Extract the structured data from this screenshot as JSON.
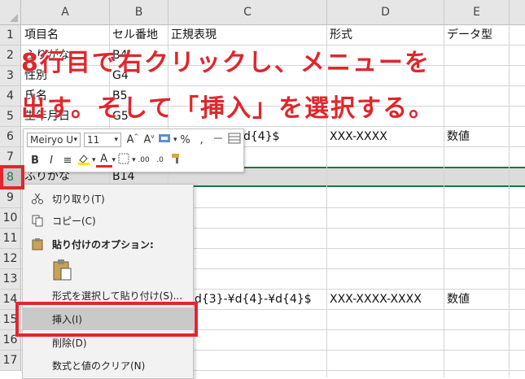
{
  "columns": [
    "A",
    "B",
    "C",
    "D",
    "E"
  ],
  "rows": [
    "1",
    "2",
    "3",
    "4",
    "5",
    "6",
    "7",
    "8",
    "9",
    "10",
    "11",
    "12",
    "13",
    "14",
    "15",
    "16",
    "17"
  ],
  "cells": {
    "r1": [
      "項目名",
      "セル番地",
      "正規表現",
      "形式",
      "データ型"
    ],
    "r2": [
      "ふりがな",
      "B4"
    ],
    "r3": [
      "性別",
      "G4"
    ],
    "r4": [
      "氏名",
      "B5"
    ],
    "r5": [
      "生年月日",
      "G5"
    ],
    "r6": [
      "d{4}$",
      "XXX-XXXX",
      "数値"
    ],
    "r8": [
      "ふりがな",
      "B14"
    ],
    "r14": [
      "d{3}-¥d{4}-¥d{4}$",
      "XXX-XXXX-XXXX",
      "数値"
    ]
  },
  "overlay": {
    "line1": "8行目で右クリックし、メニューを",
    "line2": "出す。そして「挿入」を選択する。"
  },
  "mini_toolbar": {
    "font_name": "Meiryo U",
    "font_size": "11",
    "percent": "%",
    "comma": ",",
    "bold": "B",
    "italic": "I",
    "font_color_glyph": "A"
  },
  "context_menu": {
    "cut": "切り取り(T)",
    "copy": "コピー(C)",
    "paste_options": "貼り付けのオプション:",
    "paste_special": "形式を選択して貼り付け(S)...",
    "insert": "挿入(I)",
    "delete": "削除(D)",
    "clear": "数式と値のクリア(N)"
  },
  "colors": {
    "highlight_red": "#e2262c",
    "excel_green": "#217346"
  }
}
